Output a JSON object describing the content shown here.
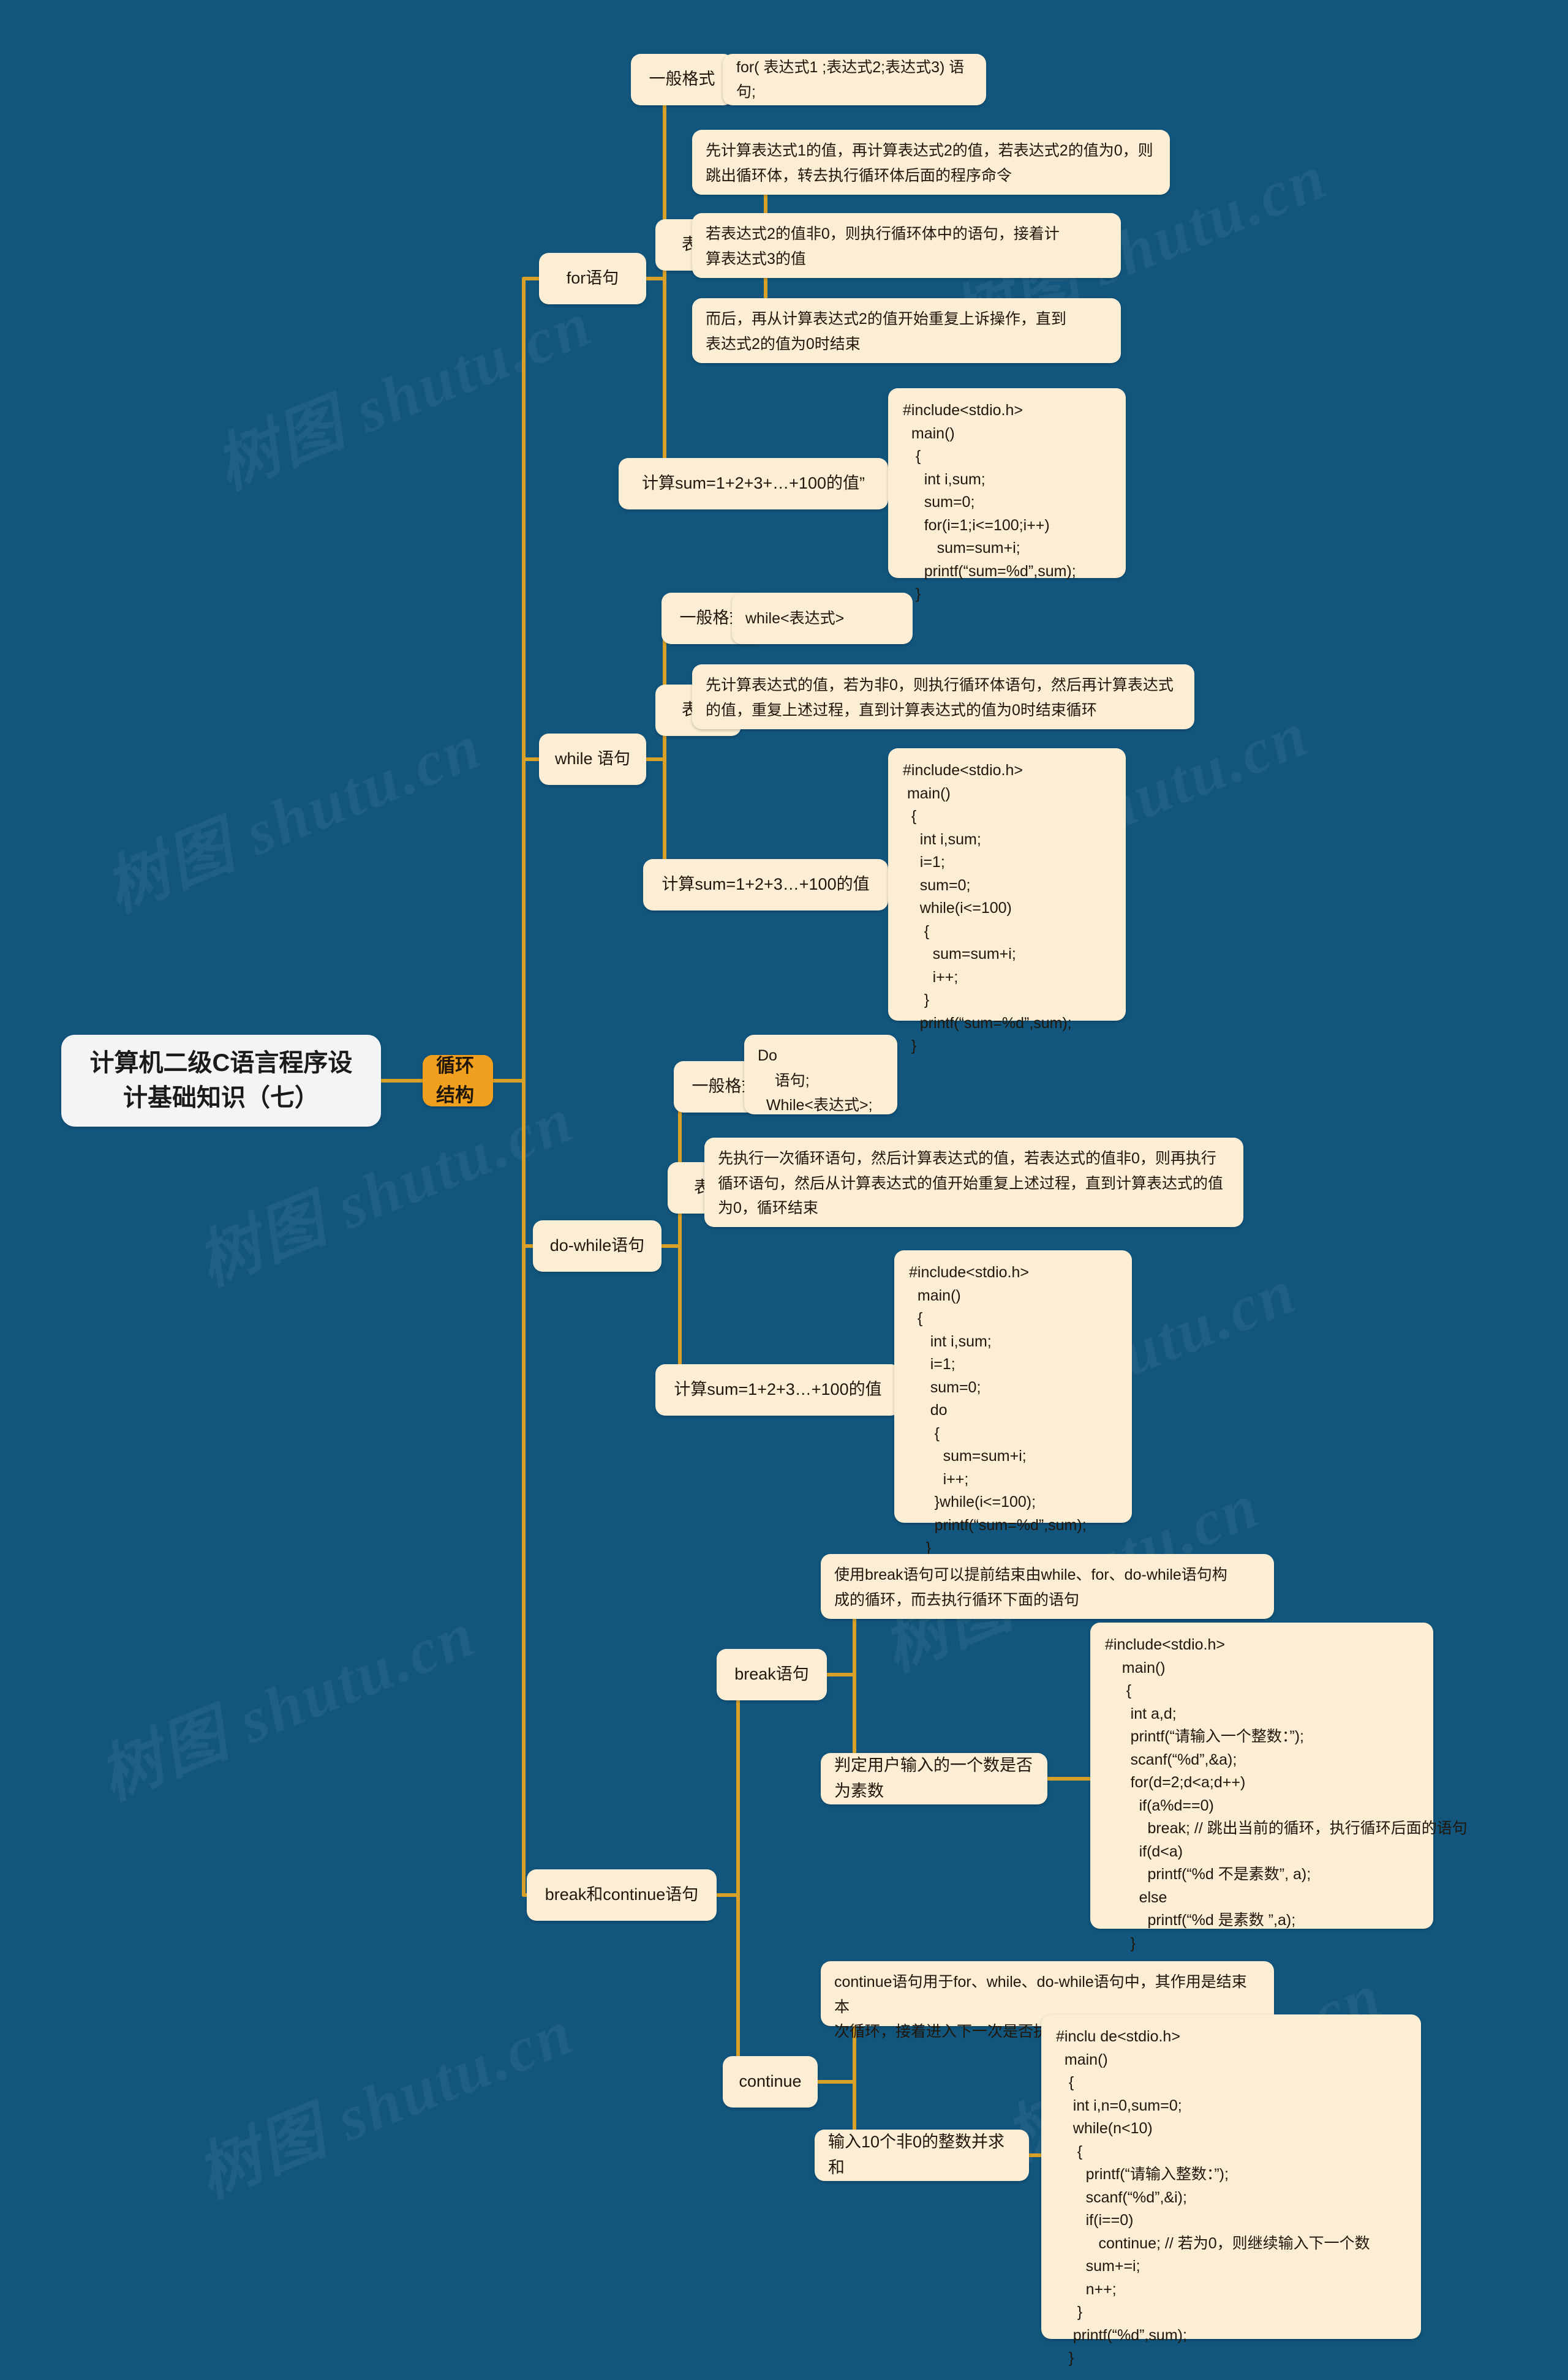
{
  "theme": {
    "background": "#12567e",
    "branch_color": "#f0a01e",
    "node_fill": "#fbeed5",
    "root_fill": "#f2f4f5",
    "line_color": "#d9a127",
    "text_color": "#20160a"
  },
  "watermark_text": "树图 shutu.cn",
  "root": {
    "label": "计算机二级C语言程序设\n计基础知识（七）"
  },
  "branch": {
    "label": "循环结构"
  },
  "topics": {
    "for": "for语句",
    "while": "while 语句",
    "dowhile": "do-while语句",
    "breakcontinue": "break和continue语句"
  },
  "subtopics": {
    "format": "一般格式",
    "represent": "表示",
    "for_example_label": "计算sum=1+2+3+…+100的值”",
    "while_example_label": "计算sum=1+2+3…+100的值",
    "dowhile_example_label": "计算sum=1+2+3…+100的值",
    "break_stmt": "break语句",
    "continue_stmt": "continue",
    "prime_label": "判定用户输入的一个数是否为素数",
    "sum10_label": "输入10个非0的整数并求和"
  },
  "for_section": {
    "format_value": "for( 表达式1 ;表达式2;表达式3) 语句;",
    "represent_1": "先计算表达式1的值，再计算表达式2的值，若表达式2的值为0，则\n跳出循环体，转去执行循环体后面的程序命令",
    "represent_2": "若表达式2的值非0，则执行循环体中的语句，接着计\n算表达式3的值",
    "represent_3": "而后，再从计算表达式2的值开始重复上诉操作，直到\n表达式2的值为0时结束",
    "code": "#include<stdio.h>\n  main()\n   {\n     int i,sum;\n     sum=0;\n     for(i=1;i<=100;i++)\n        sum=sum+i;\n     printf(“sum=%d”,sum);\n   }"
  },
  "while_section": {
    "format_value": "while<表达式>",
    "represent_1": "先计算表达式的值，若为非0，则执行循环体语句，然后再计算表达式\n的值，重复上述过程，直到计算表达式的值为0时结束循环",
    "code": "#include<stdio.h>\n main()\n  {\n    int i,sum;\n    i=1;\n    sum=0;\n    while(i<=100)\n     {\n       sum=sum+i;\n       i++;\n     }\n    printf(“sum=%d”,sum);\n  }"
  },
  "dowhile_section": {
    "format_value": "Do\n    语句;\n  While<表达式>;",
    "represent_1": "先执行一次循环语句，然后计算表达式的值，若表达式的值非0，则再执行\n循环语句，然后从计算表达式的值开始重复上述过程，直到计算表达式的值\n为0，循环结束",
    "code": "#include<stdio.h>\n  main()\n  {\n     int i,sum;\n     i=1;\n     sum=0;\n     do\n      {\n        sum=sum+i;\n        i++;\n      }while(i<=100);\n      printf(“sum=%d”,sum);\n    }"
  },
  "break_section": {
    "desc": "使用break语句可以提前结束由while、for、do-while语句构\n成的循环，而去执行循环下面的语句",
    "code": "#include<stdio.h>\n    main()\n     {\n      int a,d;\n      printf(“请输入一个整数：”);\n      scanf(“%d”,&a);\n      for(d=2;d<a;d++)\n        if(a%d==0)\n          break; // 跳出当前的循环，执行循环后面的语句\n        if(d<a)\n          printf(“%d 不是素数”, a);\n        else\n          printf(“%d 是素数 ”,a);\n      }"
  },
  "continue_section": {
    "desc": "continue语句用于for、while、do-while语句中，其作用是结束本\n次循环，接着进入下一次是否执行循环的判断",
    "code": "#inclu de<stdio.h>\n  main()\n   {\n    int i,n=0,sum=0;\n    while(n<10)\n     {\n       printf(“请输入整数：”);\n       scanf(“%d”,&i);\n       if(i==0)\n          continue; // 若为0，则继续输入下一个数\n       sum+=i;\n       n++;\n     }\n    printf(“%d”,sum);\n   }"
  }
}
